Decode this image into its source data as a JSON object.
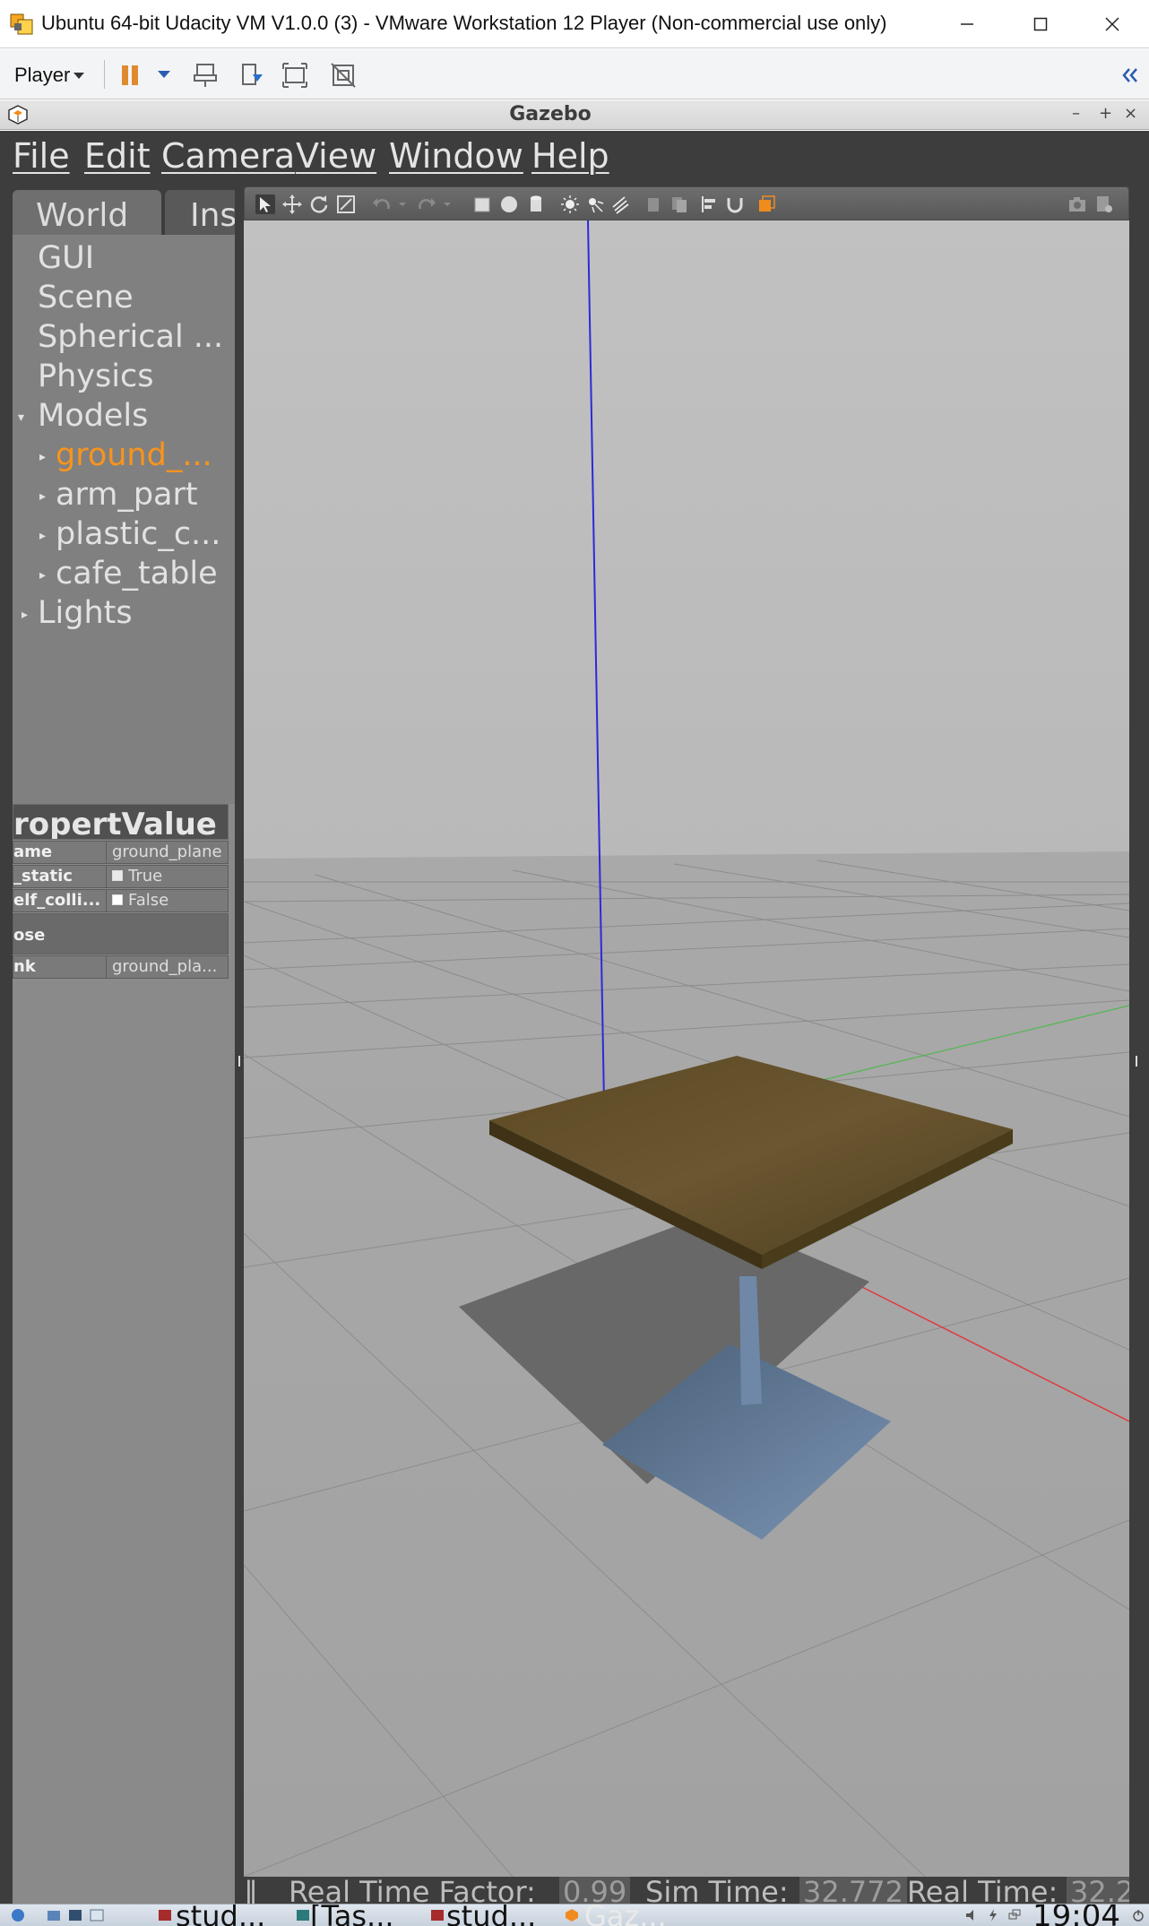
{
  "window": {
    "title": "Ubuntu 64-bit Udacity VM V1.0.0 (3) - VMware Workstation 12 Player (Non-commercial use only)"
  },
  "vmware_toolbar": {
    "player_label": "Player",
    "icons": [
      "pause-icon",
      "dropdown-icon",
      "send-ctrl-alt-del-icon",
      "removable-devices-icon",
      "fullscreen-icon",
      "unity-icon",
      "collapse-icon"
    ]
  },
  "gazebo": {
    "title": "Gazebo",
    "menu": [
      "File",
      "Edit",
      "Camera",
      "View",
      "Window",
      "Help"
    ],
    "tabs": [
      "World",
      "Ins"
    ],
    "tree": {
      "root_items": [
        "GUI",
        "Scene",
        "Spherical ...",
        "Physics"
      ],
      "models_label": "Models",
      "models": [
        "ground_...",
        "arm_part",
        "plastic_c...",
        "cafe_table"
      ],
      "lights_label": "Lights"
    },
    "properties": {
      "header": "ropertValue",
      "rows": [
        {
          "key": "ame",
          "value": "ground_plane",
          "checkbox": ""
        },
        {
          "key": "_static",
          "value": "True",
          "checkbox": "checked"
        },
        {
          "key": "elf_colli...",
          "value": "False",
          "checkbox": "unchecked"
        }
      ],
      "pose_label": "ose",
      "link_row": {
        "key": "nk",
        "value": "ground_pla..."
      }
    },
    "status_bar": {
      "pause_glyph": "‖",
      "real_time_factor_label": "Real Time Factor:",
      "real_time_factor_value": "0.99",
      "sim_time_label": "Sim Time:",
      "sim_time_value": "32.772",
      "real_time_label": "Real Time:",
      "real_time_value": "32.2"
    }
  },
  "taskbar": {
    "tasks": [
      "stud...",
      "[Tas...",
      "stud...",
      "Gaz..."
    ],
    "clock": "19:04"
  },
  "colors": {
    "accent_orange": "#f08c1e",
    "selected_tree_item": "#f7941d",
    "viewport_sky": "#bcbcbc",
    "viewport_ground": "#a3a3a3",
    "table_top": "#5e4b26"
  }
}
